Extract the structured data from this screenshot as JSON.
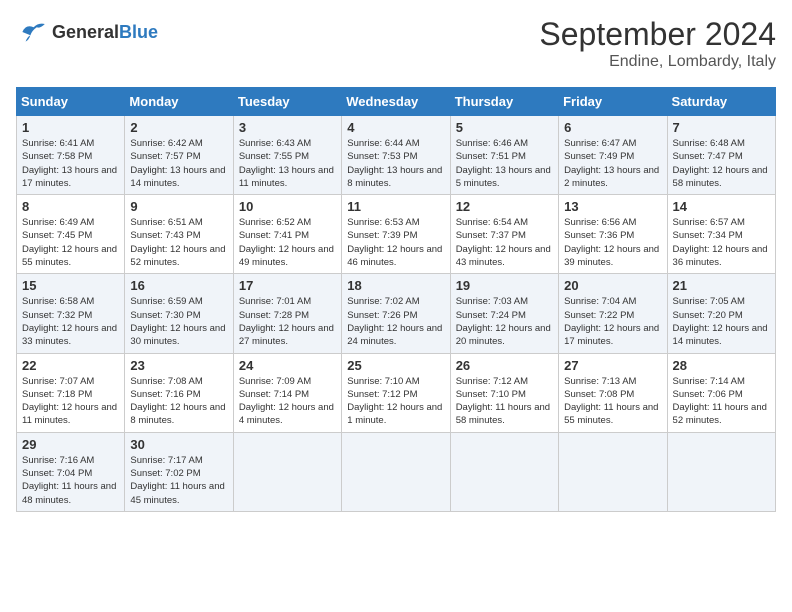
{
  "header": {
    "logo_general": "General",
    "logo_blue": "Blue",
    "title": "September 2024",
    "subtitle": "Endine, Lombardy, Italy"
  },
  "columns": [
    "Sunday",
    "Monday",
    "Tuesday",
    "Wednesday",
    "Thursday",
    "Friday",
    "Saturday"
  ],
  "weeks": [
    [
      {
        "day": "1",
        "sunrise": "Sunrise: 6:41 AM",
        "sunset": "Sunset: 7:58 PM",
        "daylight": "Daylight: 13 hours and 17 minutes."
      },
      {
        "day": "2",
        "sunrise": "Sunrise: 6:42 AM",
        "sunset": "Sunset: 7:57 PM",
        "daylight": "Daylight: 13 hours and 14 minutes."
      },
      {
        "day": "3",
        "sunrise": "Sunrise: 6:43 AM",
        "sunset": "Sunset: 7:55 PM",
        "daylight": "Daylight: 13 hours and 11 minutes."
      },
      {
        "day": "4",
        "sunrise": "Sunrise: 6:44 AM",
        "sunset": "Sunset: 7:53 PM",
        "daylight": "Daylight: 13 hours and 8 minutes."
      },
      {
        "day": "5",
        "sunrise": "Sunrise: 6:46 AM",
        "sunset": "Sunset: 7:51 PM",
        "daylight": "Daylight: 13 hours and 5 minutes."
      },
      {
        "day": "6",
        "sunrise": "Sunrise: 6:47 AM",
        "sunset": "Sunset: 7:49 PM",
        "daylight": "Daylight: 13 hours and 2 minutes."
      },
      {
        "day": "7",
        "sunrise": "Sunrise: 6:48 AM",
        "sunset": "Sunset: 7:47 PM",
        "daylight": "Daylight: 12 hours and 58 minutes."
      }
    ],
    [
      {
        "day": "8",
        "sunrise": "Sunrise: 6:49 AM",
        "sunset": "Sunset: 7:45 PM",
        "daylight": "Daylight: 12 hours and 55 minutes."
      },
      {
        "day": "9",
        "sunrise": "Sunrise: 6:51 AM",
        "sunset": "Sunset: 7:43 PM",
        "daylight": "Daylight: 12 hours and 52 minutes."
      },
      {
        "day": "10",
        "sunrise": "Sunrise: 6:52 AM",
        "sunset": "Sunset: 7:41 PM",
        "daylight": "Daylight: 12 hours and 49 minutes."
      },
      {
        "day": "11",
        "sunrise": "Sunrise: 6:53 AM",
        "sunset": "Sunset: 7:39 PM",
        "daylight": "Daylight: 12 hours and 46 minutes."
      },
      {
        "day": "12",
        "sunrise": "Sunrise: 6:54 AM",
        "sunset": "Sunset: 7:37 PM",
        "daylight": "Daylight: 12 hours and 43 minutes."
      },
      {
        "day": "13",
        "sunrise": "Sunrise: 6:56 AM",
        "sunset": "Sunset: 7:36 PM",
        "daylight": "Daylight: 12 hours and 39 minutes."
      },
      {
        "day": "14",
        "sunrise": "Sunrise: 6:57 AM",
        "sunset": "Sunset: 7:34 PM",
        "daylight": "Daylight: 12 hours and 36 minutes."
      }
    ],
    [
      {
        "day": "15",
        "sunrise": "Sunrise: 6:58 AM",
        "sunset": "Sunset: 7:32 PM",
        "daylight": "Daylight: 12 hours and 33 minutes."
      },
      {
        "day": "16",
        "sunrise": "Sunrise: 6:59 AM",
        "sunset": "Sunset: 7:30 PM",
        "daylight": "Daylight: 12 hours and 30 minutes."
      },
      {
        "day": "17",
        "sunrise": "Sunrise: 7:01 AM",
        "sunset": "Sunset: 7:28 PM",
        "daylight": "Daylight: 12 hours and 27 minutes."
      },
      {
        "day": "18",
        "sunrise": "Sunrise: 7:02 AM",
        "sunset": "Sunset: 7:26 PM",
        "daylight": "Daylight: 12 hours and 24 minutes."
      },
      {
        "day": "19",
        "sunrise": "Sunrise: 7:03 AM",
        "sunset": "Sunset: 7:24 PM",
        "daylight": "Daylight: 12 hours and 20 minutes."
      },
      {
        "day": "20",
        "sunrise": "Sunrise: 7:04 AM",
        "sunset": "Sunset: 7:22 PM",
        "daylight": "Daylight: 12 hours and 17 minutes."
      },
      {
        "day": "21",
        "sunrise": "Sunrise: 7:05 AM",
        "sunset": "Sunset: 7:20 PM",
        "daylight": "Daylight: 12 hours and 14 minutes."
      }
    ],
    [
      {
        "day": "22",
        "sunrise": "Sunrise: 7:07 AM",
        "sunset": "Sunset: 7:18 PM",
        "daylight": "Daylight: 12 hours and 11 minutes."
      },
      {
        "day": "23",
        "sunrise": "Sunrise: 7:08 AM",
        "sunset": "Sunset: 7:16 PM",
        "daylight": "Daylight: 12 hours and 8 minutes."
      },
      {
        "day": "24",
        "sunrise": "Sunrise: 7:09 AM",
        "sunset": "Sunset: 7:14 PM",
        "daylight": "Daylight: 12 hours and 4 minutes."
      },
      {
        "day": "25",
        "sunrise": "Sunrise: 7:10 AM",
        "sunset": "Sunset: 7:12 PM",
        "daylight": "Daylight: 12 hours and 1 minute."
      },
      {
        "day": "26",
        "sunrise": "Sunrise: 7:12 AM",
        "sunset": "Sunset: 7:10 PM",
        "daylight": "Daylight: 11 hours and 58 minutes."
      },
      {
        "day": "27",
        "sunrise": "Sunrise: 7:13 AM",
        "sunset": "Sunset: 7:08 PM",
        "daylight": "Daylight: 11 hours and 55 minutes."
      },
      {
        "day": "28",
        "sunrise": "Sunrise: 7:14 AM",
        "sunset": "Sunset: 7:06 PM",
        "daylight": "Daylight: 11 hours and 52 minutes."
      }
    ],
    [
      {
        "day": "29",
        "sunrise": "Sunrise: 7:16 AM",
        "sunset": "Sunset: 7:04 PM",
        "daylight": "Daylight: 11 hours and 48 minutes."
      },
      {
        "day": "30",
        "sunrise": "Sunrise: 7:17 AM",
        "sunset": "Sunset: 7:02 PM",
        "daylight": "Daylight: 11 hours and 45 minutes."
      },
      null,
      null,
      null,
      null,
      null
    ]
  ]
}
